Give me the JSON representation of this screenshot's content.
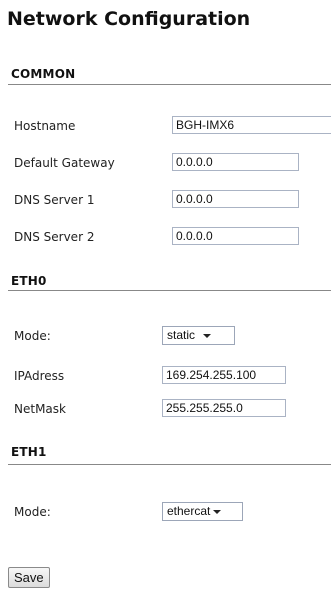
{
  "page_title": "Network Configuration",
  "common": {
    "section_label": "COMMON",
    "hostname_label": "Hostname",
    "hostname_value": "BGH-IMX6",
    "gateway_label": "Default Gateway",
    "gateway_value": "0.0.0.0",
    "dns1_label": "DNS Server 1",
    "dns1_value": "0.0.0.0",
    "dns2_label": "DNS Server 2",
    "dns2_value": "0.0.0.0"
  },
  "eth0": {
    "section_label": "ETH0",
    "mode_label": "Mode:",
    "mode_value": "static",
    "ip_label": "IPAdress",
    "ip_value": "169.254.255.100",
    "netmask_label": "NetMask",
    "netmask_value": "255.255.255.0"
  },
  "eth1": {
    "section_label": "ETH1",
    "mode_label": "Mode:",
    "mode_value": "ethercat"
  },
  "save_label": "Save"
}
